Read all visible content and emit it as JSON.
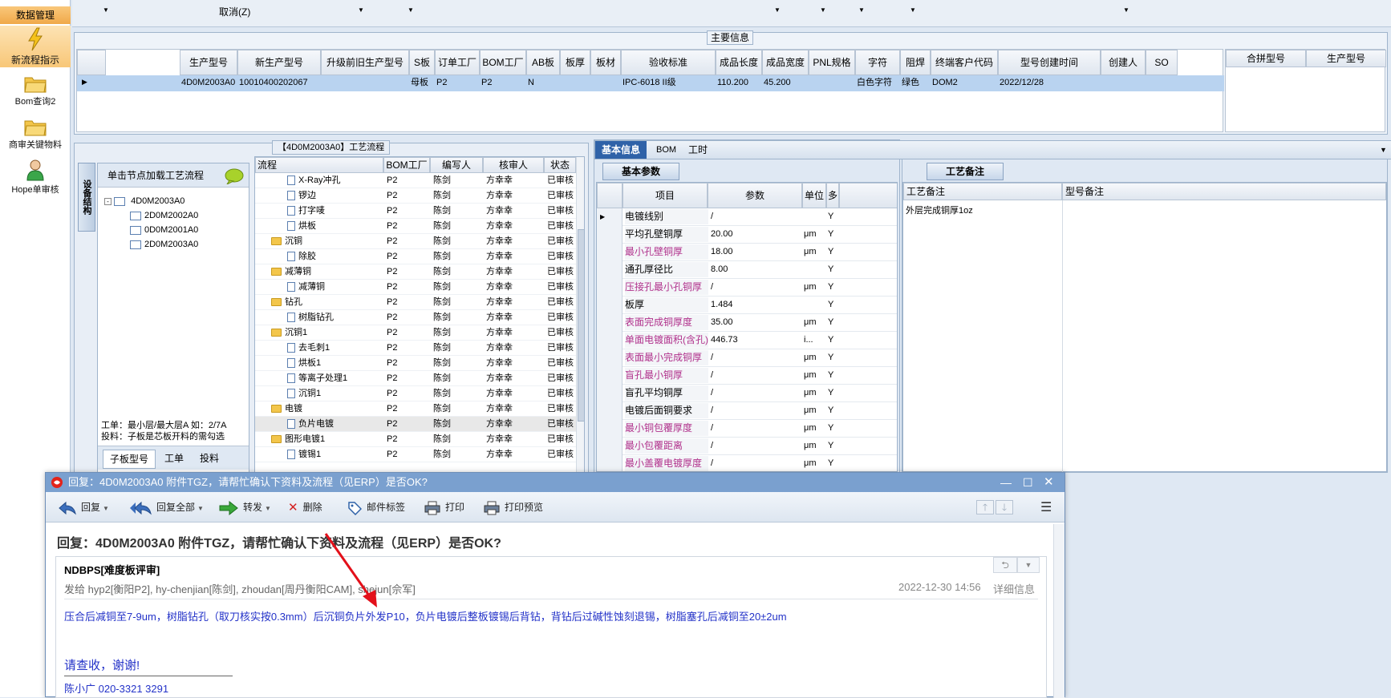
{
  "leftnav": {
    "header": "数据管理",
    "items": [
      {
        "label": "新流程指示"
      },
      {
        "label": "Bom查询2"
      },
      {
        "label": "商审关键物料"
      },
      {
        "label": "Hope单审核"
      }
    ]
  },
  "top_strip": {
    "cancel_label": "取消(Z)"
  },
  "main_info": {
    "title": "主要信息",
    "columns": [
      "生产型号",
      "新生产型号",
      "升级前旧生产型号",
      "S板",
      "订单工厂",
      "BOM工厂",
      "AB板",
      "板厚",
      "板材",
      "验收标准",
      "成品长度",
      "成品宽度",
      "PNL规格",
      "字符",
      "阻焊",
      "终端客户代码",
      "型号创建时间",
      "创建人",
      "SO"
    ],
    "row": [
      "4D0M2003A0",
      "10010400202067",
      "",
      "母板",
      "P2",
      "P2",
      "N",
      "",
      "",
      "IPC-6018 II级",
      "110.200",
      "45.200",
      "",
      "白色字符",
      "绿色",
      "DOM2",
      "2022/12/28",
      "",
      ""
    ],
    "right_columns": [
      "合拼型号",
      "生产型号"
    ]
  },
  "process": {
    "title": "【4D0M2003A0】工艺流程",
    "side_tab": "设备结构",
    "load_hint": "单击节点加载工艺流程",
    "tree": [
      "4D0M2003A0",
      "2D0M2002A0",
      "0D0M2001A0",
      "2D0M2003A0"
    ],
    "note_line1": "工单：最小层/最大层A 如：2/7A",
    "note_line2": "投料：子板是芯板开料的需勾选",
    "bottom_tabs": [
      "子板型号",
      "工单",
      "投料"
    ],
    "columns": [
      "流程",
      "BOM工厂",
      "编写人",
      "核审人",
      "状态"
    ],
    "rows": [
      {
        "name": "X-Ray冲孔",
        "type": "doc",
        "indent": 2,
        "factory": "P2",
        "writer": "陈剑",
        "reviewer": "方幸幸",
        "status": "已审核"
      },
      {
        "name": "锣边",
        "type": "doc",
        "indent": 2,
        "factory": "P2",
        "writer": "陈剑",
        "reviewer": "方幸幸",
        "status": "已审核"
      },
      {
        "name": "打字唛",
        "type": "doc",
        "indent": 2,
        "factory": "P2",
        "writer": "陈剑",
        "reviewer": "方幸幸",
        "status": "已审核"
      },
      {
        "name": "烘板",
        "type": "doc",
        "indent": 2,
        "factory": "P2",
        "writer": "陈剑",
        "reviewer": "方幸幸",
        "status": "已审核"
      },
      {
        "name": "沉铜",
        "type": "folder",
        "indent": 1,
        "factory": "P2",
        "writer": "陈剑",
        "reviewer": "方幸幸",
        "status": "已审核"
      },
      {
        "name": "除胶",
        "type": "doc",
        "indent": 2,
        "factory": "P2",
        "writer": "陈剑",
        "reviewer": "方幸幸",
        "status": "已审核"
      },
      {
        "name": "减薄铜",
        "type": "folder",
        "indent": 1,
        "factory": "P2",
        "writer": "陈剑",
        "reviewer": "方幸幸",
        "status": "已审核"
      },
      {
        "name": "减薄铜",
        "type": "doc",
        "indent": 2,
        "factory": "P2",
        "writer": "陈剑",
        "reviewer": "方幸幸",
        "status": "已审核"
      },
      {
        "name": "钻孔",
        "type": "folder",
        "indent": 1,
        "factory": "P2",
        "writer": "陈剑",
        "reviewer": "方幸幸",
        "status": "已审核"
      },
      {
        "name": "树脂钻孔",
        "type": "doc",
        "indent": 2,
        "factory": "P2",
        "writer": "陈剑",
        "reviewer": "方幸幸",
        "status": "已审核"
      },
      {
        "name": "沉铜1",
        "type": "folder",
        "indent": 1,
        "factory": "P2",
        "writer": "陈剑",
        "reviewer": "方幸幸",
        "status": "已审核"
      },
      {
        "name": "去毛刺1",
        "type": "doc",
        "indent": 2,
        "factory": "P2",
        "writer": "陈剑",
        "reviewer": "方幸幸",
        "status": "已审核"
      },
      {
        "name": "烘板1",
        "type": "doc",
        "indent": 2,
        "factory": "P2",
        "writer": "陈剑",
        "reviewer": "方幸幸",
        "status": "已审核"
      },
      {
        "name": "等离子处理1",
        "type": "doc",
        "indent": 2,
        "factory": "P2",
        "writer": "陈剑",
        "reviewer": "方幸幸",
        "status": "已审核"
      },
      {
        "name": "沉铜1",
        "type": "doc",
        "indent": 2,
        "factory": "P2",
        "writer": "陈剑",
        "reviewer": "方幸幸",
        "status": "已审核"
      },
      {
        "name": "电镀",
        "type": "folder",
        "indent": 1,
        "factory": "P2",
        "writer": "陈剑",
        "reviewer": "方幸幸",
        "status": "已审核"
      },
      {
        "name": "负片电镀",
        "type": "doc",
        "indent": 2,
        "factory": "P2",
        "writer": "陈剑",
        "reviewer": "方幸幸",
        "status": "已审核"
      },
      {
        "name": "图形电镀1",
        "type": "folder",
        "indent": 1,
        "factory": "P2",
        "writer": "陈剑",
        "reviewer": "方幸幸",
        "status": "已审核"
      },
      {
        "name": "镀锡1",
        "type": "doc",
        "indent": 2,
        "factory": "P2",
        "writer": "陈剑",
        "reviewer": "方幸幸",
        "status": "已审核"
      }
    ]
  },
  "params": {
    "tabs": [
      "基本信息",
      "BOM",
      "工时"
    ],
    "subtab": "基本参数",
    "columns": [
      "项目",
      "参数",
      "单位",
      "多"
    ],
    "rows": [
      {
        "item": "电镀线别",
        "value": "/",
        "unit": "",
        "flag": "Y",
        "pink": false
      },
      {
        "item": "平均孔壁铜厚",
        "value": "20.00",
        "unit": "μm",
        "flag": "Y",
        "pink": false
      },
      {
        "item": "最小孔壁铜厚",
        "value": "18.00",
        "unit": "μm",
        "flag": "Y",
        "pink": true
      },
      {
        "item": "通孔厚径比",
        "value": "8.00",
        "unit": "",
        "flag": "Y",
        "pink": false
      },
      {
        "item": "压接孔最小孔铜厚",
        "value": "/",
        "unit": "μm",
        "flag": "Y",
        "pink": true
      },
      {
        "item": "板厚",
        "value": "1.484",
        "unit": "",
        "flag": "Y",
        "pink": false
      },
      {
        "item": "表面完成铜厚度",
        "value": "35.00",
        "unit": "μm",
        "flag": "Y",
        "pink": true
      },
      {
        "item": "单面电镀面积(含孔)",
        "value": "446.73",
        "unit": "i...",
        "flag": "Y",
        "pink": true
      },
      {
        "item": "表面最小完成铜厚",
        "value": "/",
        "unit": "μm",
        "flag": "Y",
        "pink": true
      },
      {
        "item": "盲孔最小铜厚",
        "value": "/",
        "unit": "μm",
        "flag": "Y",
        "pink": true
      },
      {
        "item": "盲孔平均铜厚",
        "value": "/",
        "unit": "μm",
        "flag": "Y",
        "pink": false
      },
      {
        "item": "电镀后面铜要求",
        "value": "/",
        "unit": "μm",
        "flag": "Y",
        "pink": false
      },
      {
        "item": "最小铜包覆厚度",
        "value": "/",
        "unit": "μm",
        "flag": "Y",
        "pink": true
      },
      {
        "item": "最小包覆距离",
        "value": "/",
        "unit": "μm",
        "flag": "Y",
        "pink": true
      },
      {
        "item": "最小盖覆电镀厚度",
        "value": "/",
        "unit": "μm",
        "flag": "Y",
        "pink": true
      }
    ]
  },
  "notes": {
    "tab": "工艺备注",
    "columns": [
      "工艺备注",
      "型号备注"
    ],
    "value": "外层完成铜厚1oz"
  },
  "email": {
    "window_title": "回复：4D0M2003A0 附件TGZ，请帮忙确认下资料及流程（见ERP）是否OK?",
    "toolbar": [
      "回复",
      "回复全部",
      "转发",
      "删除",
      "邮件标签",
      "打印",
      "打印预览"
    ],
    "subject": "回复：4D0M2003A0 附件TGZ，请帮忙确认下资料及流程（见ERP）是否OK?",
    "sender": "NDBPS[难度板评审]",
    "to_line": "发给 hyp2[衡阳P2], hy-chenjian[陈剑], zhoudan[周丹衡阳CAM], shejun[佘军]",
    "datetime": "2022-12-30 14:56",
    "details": "详细信息",
    "body": "压合后减铜至7-9um，树脂钻孔（取刀核实按0.3mm）后沉铜负片外发P10，负片电镀后整板镀锡后背钻，背钻后过碱性蚀刻退锡，树脂塞孔后减铜至20±2um",
    "thanks": "请查收，谢谢!",
    "signature": "陈小广 020-3321 3291"
  },
  "colors": {
    "accent": "#7aa0cf",
    "selected_row": "#b9d3f0",
    "link_blue": "#2332c8",
    "pink": "#b0308b",
    "arrow": "#e3101a"
  }
}
